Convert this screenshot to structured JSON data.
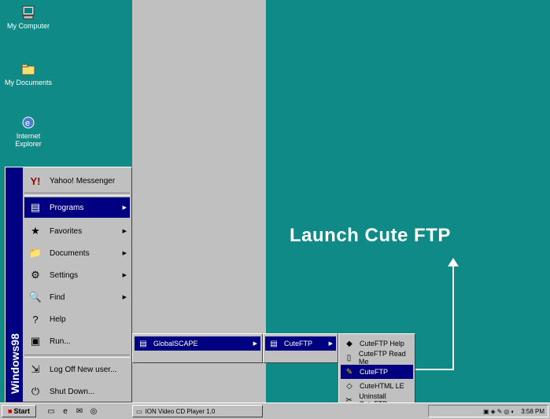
{
  "desktop_icons": [
    {
      "label": "My Computer",
      "icon": "computer-icon"
    },
    {
      "label": "My Documents",
      "icon": "folder-icon"
    },
    {
      "label": "Internet Explorer",
      "icon": "ie-icon"
    }
  ],
  "start_menu": {
    "sidebar_text": "Windows98",
    "items": [
      {
        "label": "Yahoo! Messenger",
        "icon": "yahoo-icon"
      },
      {
        "label": "Programs",
        "icon": "programs-icon",
        "arrow": true
      },
      {
        "label": "Favorites",
        "icon": "favorites-icon",
        "arrow": true
      },
      {
        "label": "Documents",
        "icon": "documents-icon",
        "arrow": true
      },
      {
        "label": "Settings",
        "icon": "settings-icon",
        "arrow": true
      },
      {
        "label": "Find",
        "icon": "find-icon",
        "arrow": true
      },
      {
        "label": "Help",
        "icon": "help-icon"
      },
      {
        "label": "Run...",
        "icon": "run-icon"
      },
      {
        "label": "Log Off New user...",
        "icon": "logoff-icon"
      },
      {
        "label": "Shut Down...",
        "icon": "shutdown-icon"
      }
    ]
  },
  "programs_submenu": {
    "selected": "GlobalSCAPE"
  },
  "globalscape_submenu": {
    "selected": "CuteFTP"
  },
  "cuteftp_submenu": {
    "items": [
      {
        "label": "CuteFTP Help"
      },
      {
        "label": "CuteFTP Read Me"
      },
      {
        "label": "CuteFTP"
      },
      {
        "label": "CuteHTML LE"
      },
      {
        "label": "Uninstall CuteFTP"
      }
    ],
    "selected_index": 2
  },
  "annotation": {
    "text": "Launch  Cute FTP"
  },
  "taskbar": {
    "start_label": "Start",
    "task_label": "ION Video CD Player 1.0",
    "clock": "3:58 PM"
  },
  "colors": {
    "desktop": "#0f8a86",
    "menu": "#c0c0c0",
    "highlight": "#000080"
  }
}
